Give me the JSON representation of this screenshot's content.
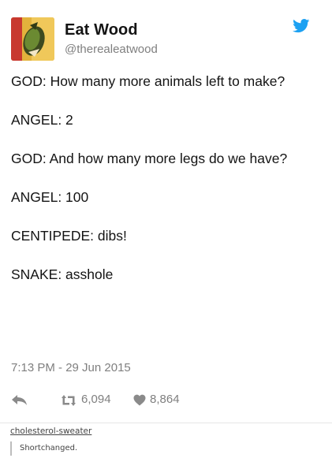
{
  "tweet": {
    "display_name": "Eat Wood",
    "handle": "@therealeatwood",
    "avatar_icon": "eat-wood-avatar-icon",
    "brand_icon": "twitter-bird-icon",
    "accent_color": "#1da1f2",
    "lines": [
      "GOD: How many more animals left to make?",
      "ANGEL: 2",
      "GOD: And how many more legs do we have?",
      "ANGEL: 100",
      "CENTIPEDE: dibs!",
      "SNAKE: asshole"
    ],
    "timestamp": "7:13 PM - 29 Jun 2015",
    "actions": {
      "reply_icon": "reply-icon",
      "retweet_icon": "retweet-icon",
      "retweets": "6,094",
      "like_icon": "heart-icon",
      "likes": "8,864"
    }
  },
  "reblog": {
    "username": "cholesterol-sweater",
    "comment": "Shortchanged."
  }
}
